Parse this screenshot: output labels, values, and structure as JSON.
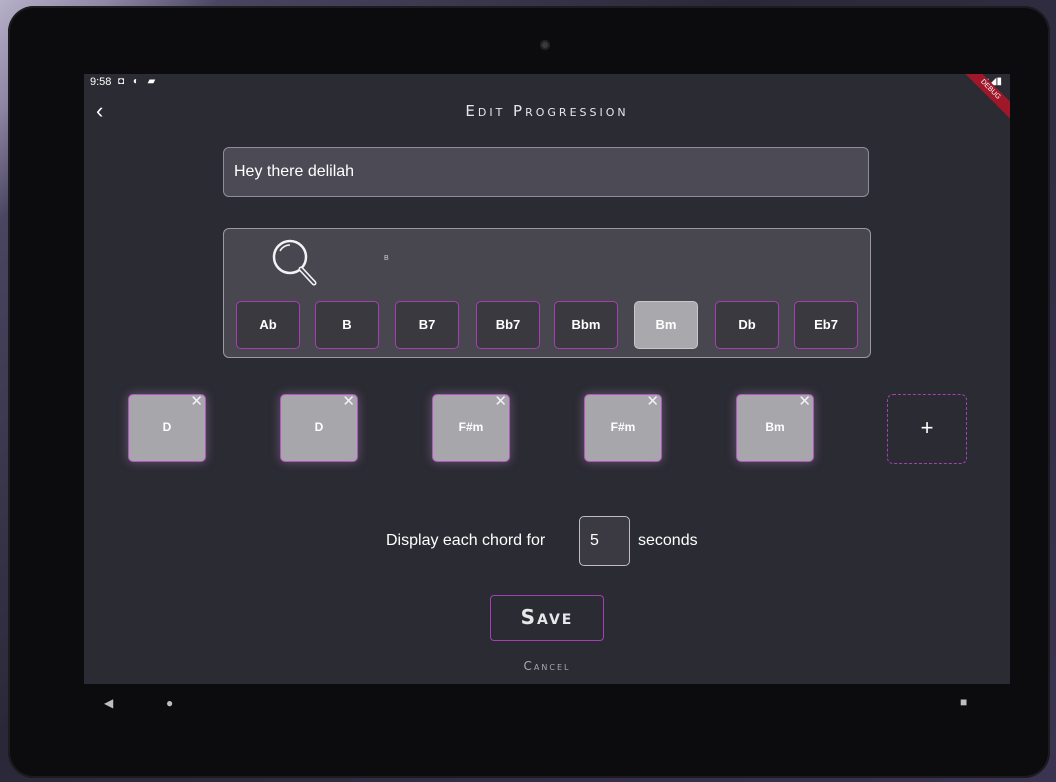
{
  "status_bar": {
    "time": "9:58",
    "left_icons": "◘ ◐ ▰",
    "right_icons": "▾◢▮",
    "debug_label": "DEBUG"
  },
  "header": {
    "back_icon": "‹",
    "title": "Edit Progression"
  },
  "progression_name": {
    "value": "Hey there delilah"
  },
  "chord_search": {
    "query": "B",
    "options": [
      {
        "label": "Ab",
        "selected": false
      },
      {
        "label": "B",
        "selected": false
      },
      {
        "label": "B7",
        "selected": false
      },
      {
        "label": "Bb7",
        "selected": false
      },
      {
        "label": "Bbm",
        "selected": false
      },
      {
        "label": "Bm",
        "selected": true
      },
      {
        "label": "Db",
        "selected": false
      },
      {
        "label": "Eb7",
        "selected": false
      }
    ]
  },
  "progression": {
    "chords": [
      "D",
      "D",
      "F#m",
      "F#m",
      "Bm"
    ],
    "remove_icon": "✕",
    "add_icon": "+"
  },
  "duration": {
    "label_before": "Display each chord for",
    "value": "5",
    "label_after": "seconds"
  },
  "actions": {
    "save_label": "Save",
    "cancel_label": "Cancel"
  },
  "nav_bar": {
    "back_icon": "◀",
    "home_icon": "●",
    "recent_icon": "■"
  },
  "colors": {
    "accent": "#a53fb3",
    "background": "#2b2b33",
    "chord_tile": "#a7a6ab"
  }
}
